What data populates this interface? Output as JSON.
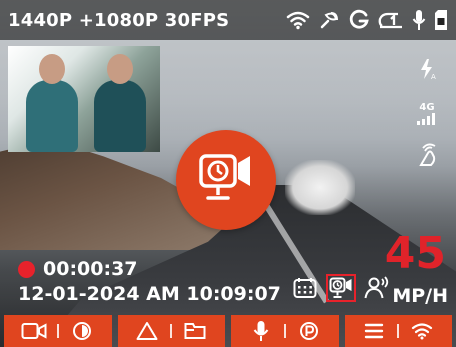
{
  "status": {
    "resolution": "1440P +1080P 30FPS",
    "icons": [
      "wifi-icon",
      "gps-icon",
      "g-sensor-icon",
      "loop-1-icon",
      "mic-icon",
      "sd-card-icon"
    ]
  },
  "side": {
    "network_label": "4G",
    "icons": [
      "auto-flash-icon",
      "4g-signal-icon",
      "gesture-icon"
    ]
  },
  "record": {
    "icon": "timelapse-camera-icon"
  },
  "recording": {
    "timer": "00:00:37",
    "datetime": "12-01-2024 AM 10:09:07"
  },
  "modes": [
    "calendar-icon",
    "timelapse-camera-icon",
    "voice-person-icon"
  ],
  "speed": {
    "value": "45",
    "unit": "MP/H"
  },
  "toolbar": {
    "groups": [
      [
        "video-camera-icon",
        "contrast-icon"
      ],
      [
        "warning-triangle-icon",
        "folder-icon"
      ],
      [
        "mic-icon",
        "parking-icon"
      ],
      [
        "menu-icon",
        "wifi-icon"
      ]
    ]
  },
  "colors": {
    "accent": "#e0451f",
    "rec_red": "#e8222b",
    "speed_red": "#e0232a"
  }
}
